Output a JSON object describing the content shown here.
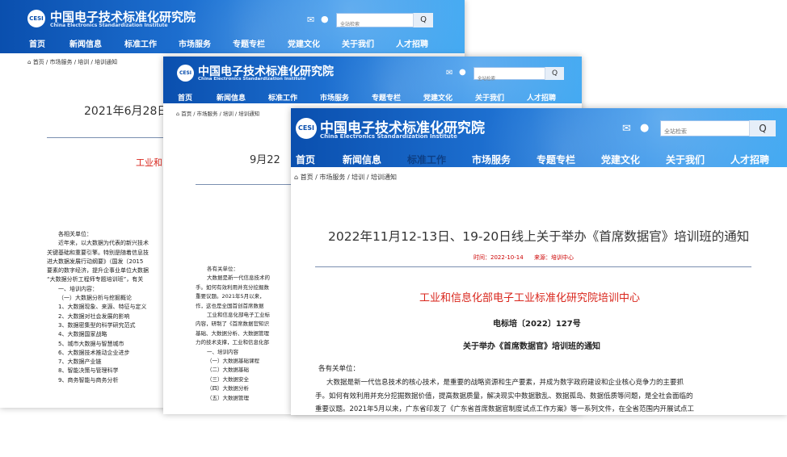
{
  "site": {
    "logo_text": "CESI",
    "name_cn": "中国电子技术标准化研究院",
    "name_en": "China Electronics Standardization Institute",
    "search_placeholder": "全站检索",
    "search_button": "Q",
    "mail_icon": "mail-icon",
    "chat_icon": "chat-icon",
    "nav": [
      "首页",
      "新闻信息",
      "标准工作",
      "市场服务",
      "专题专栏",
      "党建文化",
      "关于我们",
      "人才招聘"
    ],
    "breadcrumb": "首页 / 市场服务 / 培训 / 培训通知",
    "home_icon": "home-icon"
  },
  "windows": {
    "back": {
      "title": "2021年6月28日天",
      "red_heading": "工业和",
      "body": [
        "各相关单位：",
        "近年来，以大数据为代表的新兴技术",
        "关键基础和重要引擎。特别是随着信息技",
        "进大数据发展行动纲要》（国发〔2015",
        "要素的数字经济，提升企事业单位大数据",
        "“大数据分析工程师专题培训班”，有关",
        "一、培训内容：",
        "（一）大数据分析与挖掘概论",
        "1、大数据现象、来源、特征与定义",
        "2、大数据对社会发展的影响",
        "3、数据密集型的科学研究范式",
        "4、大数据国家战略",
        "5、城市大数据与智慧城市",
        "6、大数据技术推动企业进步",
        "7、大数据产业链",
        "8、智能决策与管理科学",
        "9、商务智能与商务分析"
      ]
    },
    "middle": {
      "title": "9月22",
      "body": [
        "各有关单位：",
        "大数据是新一代信息技术的",
        "手。如何有效利用并充分挖掘数",
        "重要议题。2021年5月以来，",
        "作，这也是全国首创首席数据",
        "工业和信息化部电子工业标",
        "内容，研制了《首席数据官知识",
        "基础、大数据分析、大数据管理",
        "力的技术支撑，工业和信息化部",
        "一、培训内容",
        "（一）大数据基础课程",
        "（二）大数据基础",
        "（三）大数据安全",
        "（四）大数据分析",
        "（五）大数据管理"
      ]
    },
    "front": {
      "title": "2022年11月12-13日、19-20日线上关于举办《首席数据官》培训班的通知",
      "time_label": "时间：2022-10-14",
      "source_label": "来源：培训中心",
      "red_heading": "工业和信息化部电子工业标准化研究院培训中心",
      "doc_number": "电标培〔2022〕127号",
      "doc_title": "关于举办《首席数据官》培训班的通知",
      "greeting": "各有关单位：",
      "paragraph": [
        "大数据是新一代信息技术的核心技术，是重要的战略资源和生产要素，并成为数字政府建设和企业核心竞争力的主要抓",
        "手。如何有效利用并充分挖掘数据价值，提高数据质量，解决现实中数据散乱、数据孤岛、数据低质等问题，是全社会面临的",
        "重要议题。2021年5月以来，广东省印发了《广东省首席数据官制度试点工作方案》等一系列文件，在全省范围内开展试点工"
      ]
    }
  },
  "colors": {
    "header_start": "#0a4fae",
    "header_end": "#44aaf2",
    "red": "#d9261c",
    "active_nav": "#0d3f85"
  }
}
